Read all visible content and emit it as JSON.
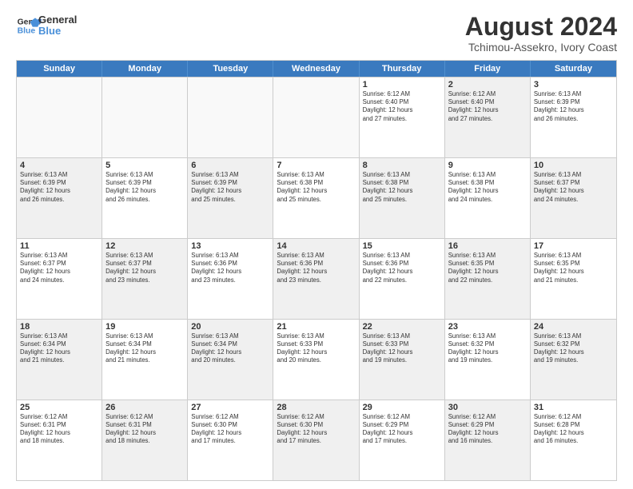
{
  "logo": {
    "line1": "General",
    "line2": "Blue"
  },
  "title": "August 2024",
  "subtitle": "Tchimou-Assekro, Ivory Coast",
  "header_days": [
    "Sunday",
    "Monday",
    "Tuesday",
    "Wednesday",
    "Thursday",
    "Friday",
    "Saturday"
  ],
  "rows": [
    [
      {
        "day": "",
        "text": "",
        "empty": true
      },
      {
        "day": "",
        "text": "",
        "empty": true
      },
      {
        "day": "",
        "text": "",
        "empty": true
      },
      {
        "day": "",
        "text": "",
        "empty": true
      },
      {
        "day": "1",
        "text": "Sunrise: 6:12 AM\nSunset: 6:40 PM\nDaylight: 12 hours\nand 27 minutes."
      },
      {
        "day": "2",
        "text": "Sunrise: 6:12 AM\nSunset: 6:40 PM\nDaylight: 12 hours\nand 27 minutes.",
        "shaded": true
      },
      {
        "day": "3",
        "text": "Sunrise: 6:13 AM\nSunset: 6:39 PM\nDaylight: 12 hours\nand 26 minutes."
      }
    ],
    [
      {
        "day": "4",
        "text": "Sunrise: 6:13 AM\nSunset: 6:39 PM\nDaylight: 12 hours\nand 26 minutes.",
        "shaded": true
      },
      {
        "day": "5",
        "text": "Sunrise: 6:13 AM\nSunset: 6:39 PM\nDaylight: 12 hours\nand 26 minutes."
      },
      {
        "day": "6",
        "text": "Sunrise: 6:13 AM\nSunset: 6:39 PM\nDaylight: 12 hours\nand 25 minutes.",
        "shaded": true
      },
      {
        "day": "7",
        "text": "Sunrise: 6:13 AM\nSunset: 6:38 PM\nDaylight: 12 hours\nand 25 minutes."
      },
      {
        "day": "8",
        "text": "Sunrise: 6:13 AM\nSunset: 6:38 PM\nDaylight: 12 hours\nand 25 minutes.",
        "shaded": true
      },
      {
        "day": "9",
        "text": "Sunrise: 6:13 AM\nSunset: 6:38 PM\nDaylight: 12 hours\nand 24 minutes."
      },
      {
        "day": "10",
        "text": "Sunrise: 6:13 AM\nSunset: 6:37 PM\nDaylight: 12 hours\nand 24 minutes.",
        "shaded": true
      }
    ],
    [
      {
        "day": "11",
        "text": "Sunrise: 6:13 AM\nSunset: 6:37 PM\nDaylight: 12 hours\nand 24 minutes."
      },
      {
        "day": "12",
        "text": "Sunrise: 6:13 AM\nSunset: 6:37 PM\nDaylight: 12 hours\nand 23 minutes.",
        "shaded": true
      },
      {
        "day": "13",
        "text": "Sunrise: 6:13 AM\nSunset: 6:36 PM\nDaylight: 12 hours\nand 23 minutes."
      },
      {
        "day": "14",
        "text": "Sunrise: 6:13 AM\nSunset: 6:36 PM\nDaylight: 12 hours\nand 23 minutes.",
        "shaded": true
      },
      {
        "day": "15",
        "text": "Sunrise: 6:13 AM\nSunset: 6:36 PM\nDaylight: 12 hours\nand 22 minutes."
      },
      {
        "day": "16",
        "text": "Sunrise: 6:13 AM\nSunset: 6:35 PM\nDaylight: 12 hours\nand 22 minutes.",
        "shaded": true
      },
      {
        "day": "17",
        "text": "Sunrise: 6:13 AM\nSunset: 6:35 PM\nDaylight: 12 hours\nand 21 minutes."
      }
    ],
    [
      {
        "day": "18",
        "text": "Sunrise: 6:13 AM\nSunset: 6:34 PM\nDaylight: 12 hours\nand 21 minutes.",
        "shaded": true
      },
      {
        "day": "19",
        "text": "Sunrise: 6:13 AM\nSunset: 6:34 PM\nDaylight: 12 hours\nand 21 minutes."
      },
      {
        "day": "20",
        "text": "Sunrise: 6:13 AM\nSunset: 6:34 PM\nDaylight: 12 hours\nand 20 minutes.",
        "shaded": true
      },
      {
        "day": "21",
        "text": "Sunrise: 6:13 AM\nSunset: 6:33 PM\nDaylight: 12 hours\nand 20 minutes."
      },
      {
        "day": "22",
        "text": "Sunrise: 6:13 AM\nSunset: 6:33 PM\nDaylight: 12 hours\nand 19 minutes.",
        "shaded": true
      },
      {
        "day": "23",
        "text": "Sunrise: 6:13 AM\nSunset: 6:32 PM\nDaylight: 12 hours\nand 19 minutes."
      },
      {
        "day": "24",
        "text": "Sunrise: 6:13 AM\nSunset: 6:32 PM\nDaylight: 12 hours\nand 19 minutes.",
        "shaded": true
      }
    ],
    [
      {
        "day": "25",
        "text": "Sunrise: 6:12 AM\nSunset: 6:31 PM\nDaylight: 12 hours\nand 18 minutes."
      },
      {
        "day": "26",
        "text": "Sunrise: 6:12 AM\nSunset: 6:31 PM\nDaylight: 12 hours\nand 18 minutes.",
        "shaded": true
      },
      {
        "day": "27",
        "text": "Sunrise: 6:12 AM\nSunset: 6:30 PM\nDaylight: 12 hours\nand 17 minutes."
      },
      {
        "day": "28",
        "text": "Sunrise: 6:12 AM\nSunset: 6:30 PM\nDaylight: 12 hours\nand 17 minutes.",
        "shaded": true
      },
      {
        "day": "29",
        "text": "Sunrise: 6:12 AM\nSunset: 6:29 PM\nDaylight: 12 hours\nand 17 minutes."
      },
      {
        "day": "30",
        "text": "Sunrise: 6:12 AM\nSunset: 6:29 PM\nDaylight: 12 hours\nand 16 minutes.",
        "shaded": true
      },
      {
        "day": "31",
        "text": "Sunrise: 6:12 AM\nSunset: 6:28 PM\nDaylight: 12 hours\nand 16 minutes."
      }
    ]
  ]
}
